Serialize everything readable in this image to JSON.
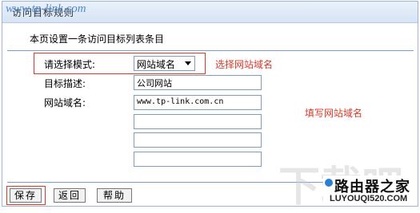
{
  "title": "访问目标规则",
  "watermark_url": "www.tp-link.com",
  "intro": "本页设置一条访问目标列表条目",
  "form": {
    "mode_label": "请选择模式:",
    "mode_value": "网站域名",
    "mode_annotation": "选择网站域名",
    "desc_label": "目标描述:",
    "desc_value": "公司网站",
    "domain_label": "网站域名:",
    "domain_values": [
      "www.tp-link.com.cn",
      "",
      "",
      ""
    ],
    "domain_annotation": "填写网站域名"
  },
  "buttons": {
    "save": "保存",
    "back": "返回",
    "help": "帮助"
  },
  "site_watermark": {
    "large": "下载吧",
    "logo_text": "路由器之家",
    "logo_url": "LUYOUQI520.COM"
  }
}
